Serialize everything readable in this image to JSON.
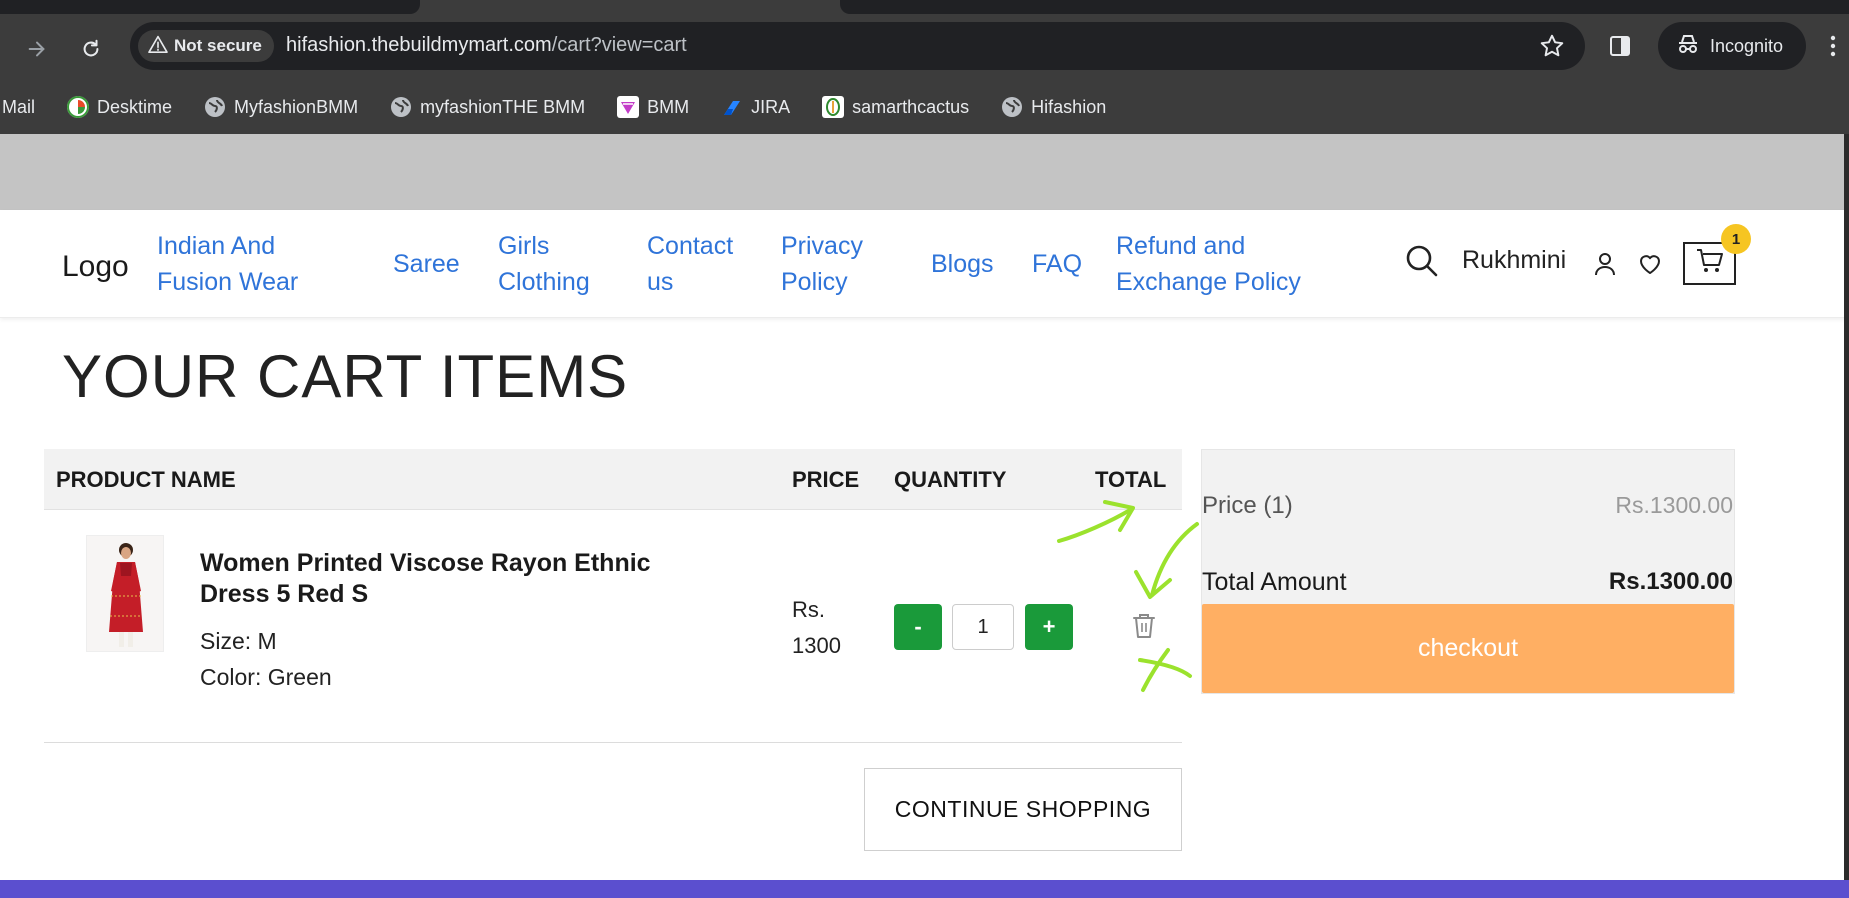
{
  "browser": {
    "security_label": "Not secure",
    "url_host": "hifashion.thebuildmymart.com",
    "url_path": "/cart?view=cart",
    "profile_label": "Incognito",
    "bookmarks": [
      {
        "label": "Mail",
        "icon": "mail-icon"
      },
      {
        "label": "Desktime",
        "icon": "desktime-icon"
      },
      {
        "label": "MyfashionBMM",
        "icon": "globe-icon"
      },
      {
        "label": "myfashionTHE BMM",
        "icon": "globe-icon"
      },
      {
        "label": "BMM",
        "icon": "bmm-icon"
      },
      {
        "label": "JIRA",
        "icon": "jira-icon"
      },
      {
        "label": "samarthcactus",
        "icon": "cactus-icon"
      },
      {
        "label": "Hifashion",
        "icon": "globe-icon"
      }
    ]
  },
  "header": {
    "logo": "Logo",
    "nav": [
      {
        "line1": "Indian And",
        "line2": "Fusion Wear"
      },
      {
        "line1": "Saree",
        "line2": ""
      },
      {
        "line1": "Girls",
        "line2": "Clothing"
      },
      {
        "line1": "Contact",
        "line2": "us"
      },
      {
        "line1": "Privacy",
        "line2": "Policy"
      },
      {
        "line1": "Blogs",
        "line2": ""
      },
      {
        "line1": "FAQ",
        "line2": ""
      },
      {
        "line1": "Refund and",
        "line2": "Exchange Policy"
      }
    ],
    "user_name": "Rukhmini",
    "cart_count": "1"
  },
  "cart": {
    "title": "YOUR CART ITEMS",
    "columns": {
      "product": "PRODUCT NAME",
      "price": "PRICE",
      "quantity": "QUANTITY",
      "total": "TOTAL"
    },
    "items": [
      {
        "name": "Women Printed Viscose Rayon Ethnic Dress 5 Red S",
        "size": "Size: M",
        "color": "Color: Green",
        "price_line1": "Rs.",
        "price_line2": "1300",
        "quantity": "1",
        "minus": "-",
        "plus": "+"
      }
    ],
    "continue_label": "CONTINUE SHOPPING"
  },
  "summary": {
    "price_label": "Price (1)",
    "price_value": "Rs.1300.00",
    "total_label": "Total Amount",
    "total_value": "Rs.1300.00",
    "checkout_label": "checkout"
  },
  "colors": {
    "nav_link": "#2f74d9",
    "qty_button": "#1a9a3a",
    "checkout": "#ffaf63",
    "badge": "#f6c522",
    "annotation": "#9be22d",
    "footer": "#5b4fcf"
  }
}
